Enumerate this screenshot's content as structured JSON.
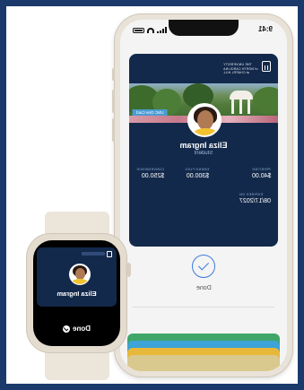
{
  "phone": {
    "status_time": "9:41",
    "card": {
      "university_lines": [
        "THE UNIVERSITY",
        "of NORTH CAROLINA",
        "at CHAPEL HILL"
      ],
      "card_name": "UNC One Card",
      "holder_name": "Eliza Ingram",
      "holder_role": "Student",
      "fields": [
        {
          "label": "CONVENIENCE",
          "value": "$250.00"
        },
        {
          "label": "DINING FLEX",
          "value": "$300.00"
        },
        {
          "label": "PRINTING",
          "value": "$40.00"
        }
      ],
      "expires_label": "EXPIRES ON",
      "expires_value": "08/17/2027"
    },
    "done_label": "Done",
    "stack_colors": [
      "#3fa66a",
      "#3ea3d6",
      "#e8b83a",
      "#d9c98e"
    ]
  },
  "watch": {
    "holder_name": "Eliza Ingram",
    "done_label": "Done"
  },
  "colors": {
    "background": "#1b3a6b",
    "card_navy": "#13294b",
    "accent_blue": "#3b7be0",
    "carolina_blue": "#4b9cd3"
  }
}
